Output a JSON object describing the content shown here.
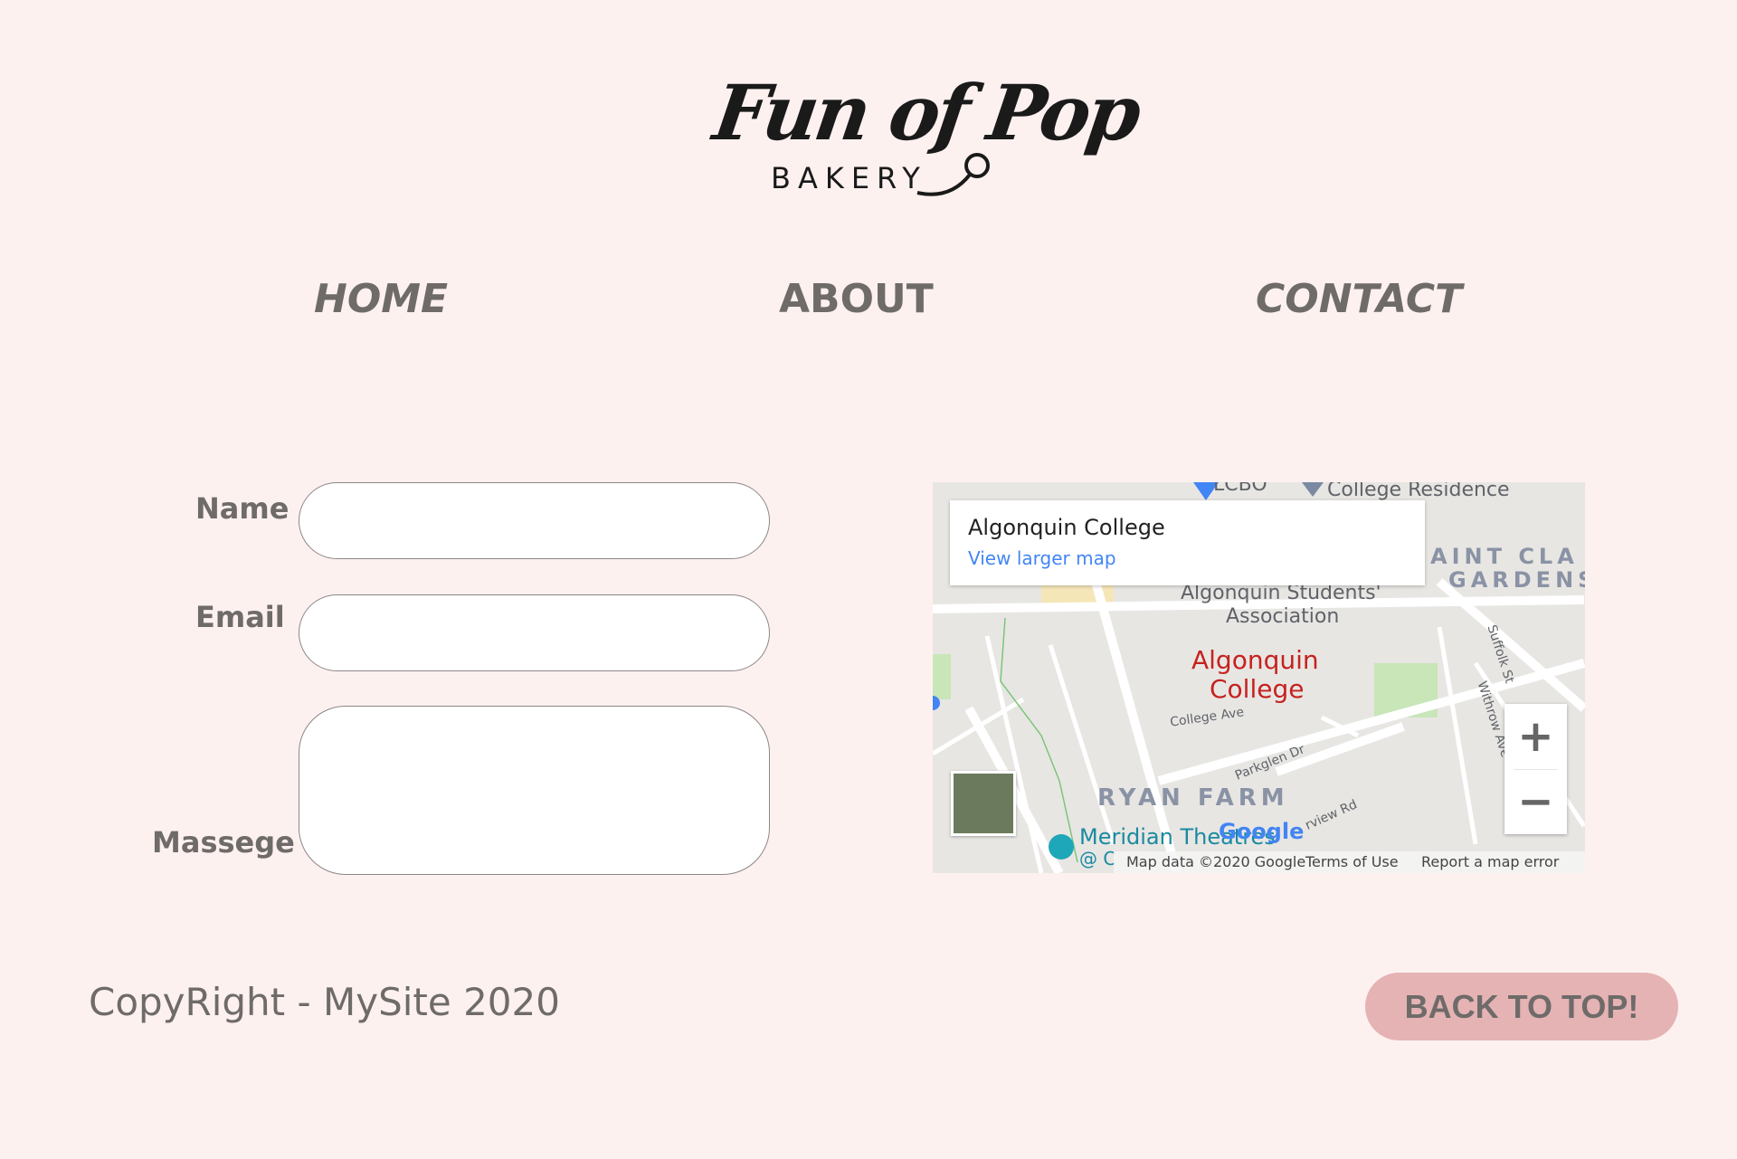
{
  "logo": {
    "script": "Fun of Pop",
    "sub": "BAKERY"
  },
  "nav": {
    "home": "HOME",
    "about": "ABOUT",
    "contact": "CONTACT"
  },
  "form": {
    "name_label": "Name",
    "email_label": "Email",
    "message_label": "Massege",
    "name_value": "",
    "email_value": "",
    "message_value": ""
  },
  "map": {
    "place_title": "Algonquin College",
    "view_larger": "View larger map",
    "lcbo": "LCBO",
    "college_residence": "College Residence",
    "saint_claire_1": "AINT CLA",
    "saint_claire_2": "GARDENS",
    "students_assoc_1": "Algonquin Students'",
    "students_assoc_2": "Association",
    "pin_1": "Algonquin",
    "pin_2": "College",
    "college_ave": "College Ave",
    "parkglen": "Parkglen Dr",
    "suffolk": "Suffolk St",
    "withrow": "Withrow Ave",
    "ryan_farm": "RYAN FARM",
    "meridian": "Meridian Theatres",
    "meridian_sub": "@ C",
    "fairview": "rview Rd",
    "google": "Google",
    "map_data": "Map data ©2020 Google",
    "terms": "Terms of Use",
    "report": "Report a map error",
    "zoom_in": "+",
    "zoom_out": "−",
    "colors": {
      "accent_red": "#c5221f",
      "link_blue": "#4285f4",
      "park_green": "#c8e6b8"
    }
  },
  "footer": {
    "copyright": "CopyRight - MySite 2020",
    "back_to_top": "BACK TO TOP!"
  }
}
